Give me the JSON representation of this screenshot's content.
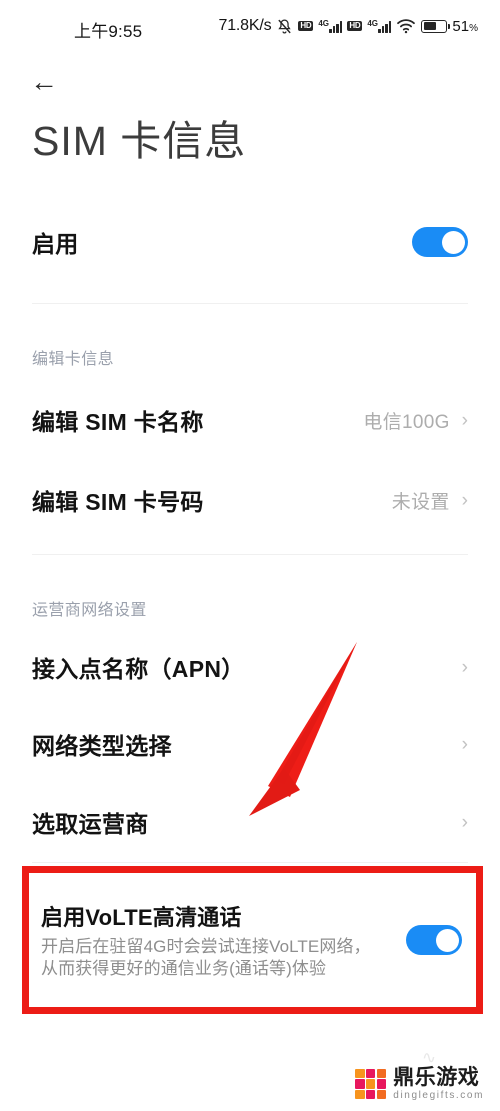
{
  "status_bar": {
    "clock": "上午9:55",
    "net_speed": "71.8K/s",
    "mute_icon": "mute-bell-icon",
    "sim1_hd": "HD",
    "sim1_gen": "4G",
    "sim2_hd": "HD",
    "sim2_gen": "4G",
    "wifi_icon": "wifi-icon",
    "battery_percent": "51",
    "battery_unit": "%"
  },
  "nav": {
    "back_icon": "←"
  },
  "header": {
    "title": "SIM 卡信息"
  },
  "enable_row": {
    "label": "启用",
    "toggle_on": true
  },
  "sections": [
    {
      "label": "编辑卡信息",
      "items": [
        {
          "title": "编辑 SIM 卡名称",
          "value": "电信100G",
          "chevron": "›"
        },
        {
          "title": "编辑 SIM 卡号码",
          "value": "未设置",
          "chevron": "›"
        }
      ]
    },
    {
      "label": "运营商网络设置",
      "items": [
        {
          "title": "接入点名称（APN）",
          "value": "",
          "chevron": "›"
        },
        {
          "title": "网络类型选择",
          "value": "",
          "chevron": "›"
        },
        {
          "title": "选取运营商",
          "value": "",
          "chevron": "›"
        }
      ]
    }
  ],
  "volte": {
    "title": "启用VoLTE高清通话",
    "description": "开启后在驻留4G时会尝试连接VoLTE网络，从而获得更好的通信业务(通话等)体验",
    "toggle_on": true,
    "highlight_color": "#ec1c16"
  },
  "annotation": {
    "arrow_color": "#ec1c16",
    "arrow_name": "red-pointer-arrow"
  },
  "watermark": {
    "name_cn": "鼎乐游戏",
    "name_en": "dinglegifts.com",
    "logo_colors": [
      "#f26b21",
      "#e8175d",
      "#f7941e"
    ]
  },
  "colors": {
    "accent_blue": "#1a8cf5",
    "text_primary": "#131313",
    "text_secondary": "#adadad",
    "section_label": "#9aa0ac",
    "divider": "#f0f0f0"
  }
}
